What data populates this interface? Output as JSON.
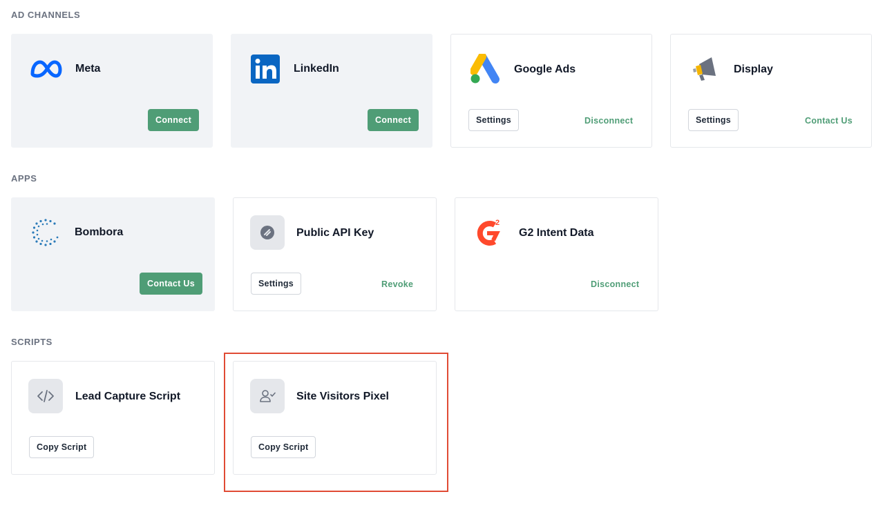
{
  "sections": {
    "ad_channels": "AD CHANNELS",
    "apps": "APPS",
    "scripts": "SCRIPTS"
  },
  "ad_channels": {
    "meta": {
      "title": "Meta",
      "action": "Connect",
      "icon": "meta-logo-icon"
    },
    "linkedin": {
      "title": "LinkedIn",
      "action": "Connect",
      "icon": "linkedin-logo-icon"
    },
    "google_ads": {
      "title": "Google Ads",
      "settings": "Settings",
      "action": "Disconnect",
      "icon": "google-ads-logo-icon"
    },
    "display": {
      "title": "Display",
      "settings": "Settings",
      "action": "Contact Us",
      "icon": "megaphone-icon"
    }
  },
  "apps": {
    "bombora": {
      "title": "Bombora",
      "action": "Contact Us",
      "icon": "bombora-logo-icon"
    },
    "public_api": {
      "title": "Public API Key",
      "settings": "Settings",
      "action": "Revoke",
      "icon": "api-key-icon"
    },
    "g2": {
      "title": "G2 Intent Data",
      "action": "Disconnect",
      "icon": "g2-logo-icon"
    }
  },
  "scripts": {
    "lead_capture": {
      "title": "Lead Capture Script",
      "action": "Copy Script",
      "icon": "code-icon"
    },
    "site_visitors": {
      "title": "Site Visitors Pixel",
      "action": "Copy Script",
      "icon": "user-check-icon"
    }
  },
  "colors": {
    "accent_green": "#4f9d76",
    "highlight_red": "#e04a33",
    "disconnected_bg": "#f1f3f6"
  }
}
